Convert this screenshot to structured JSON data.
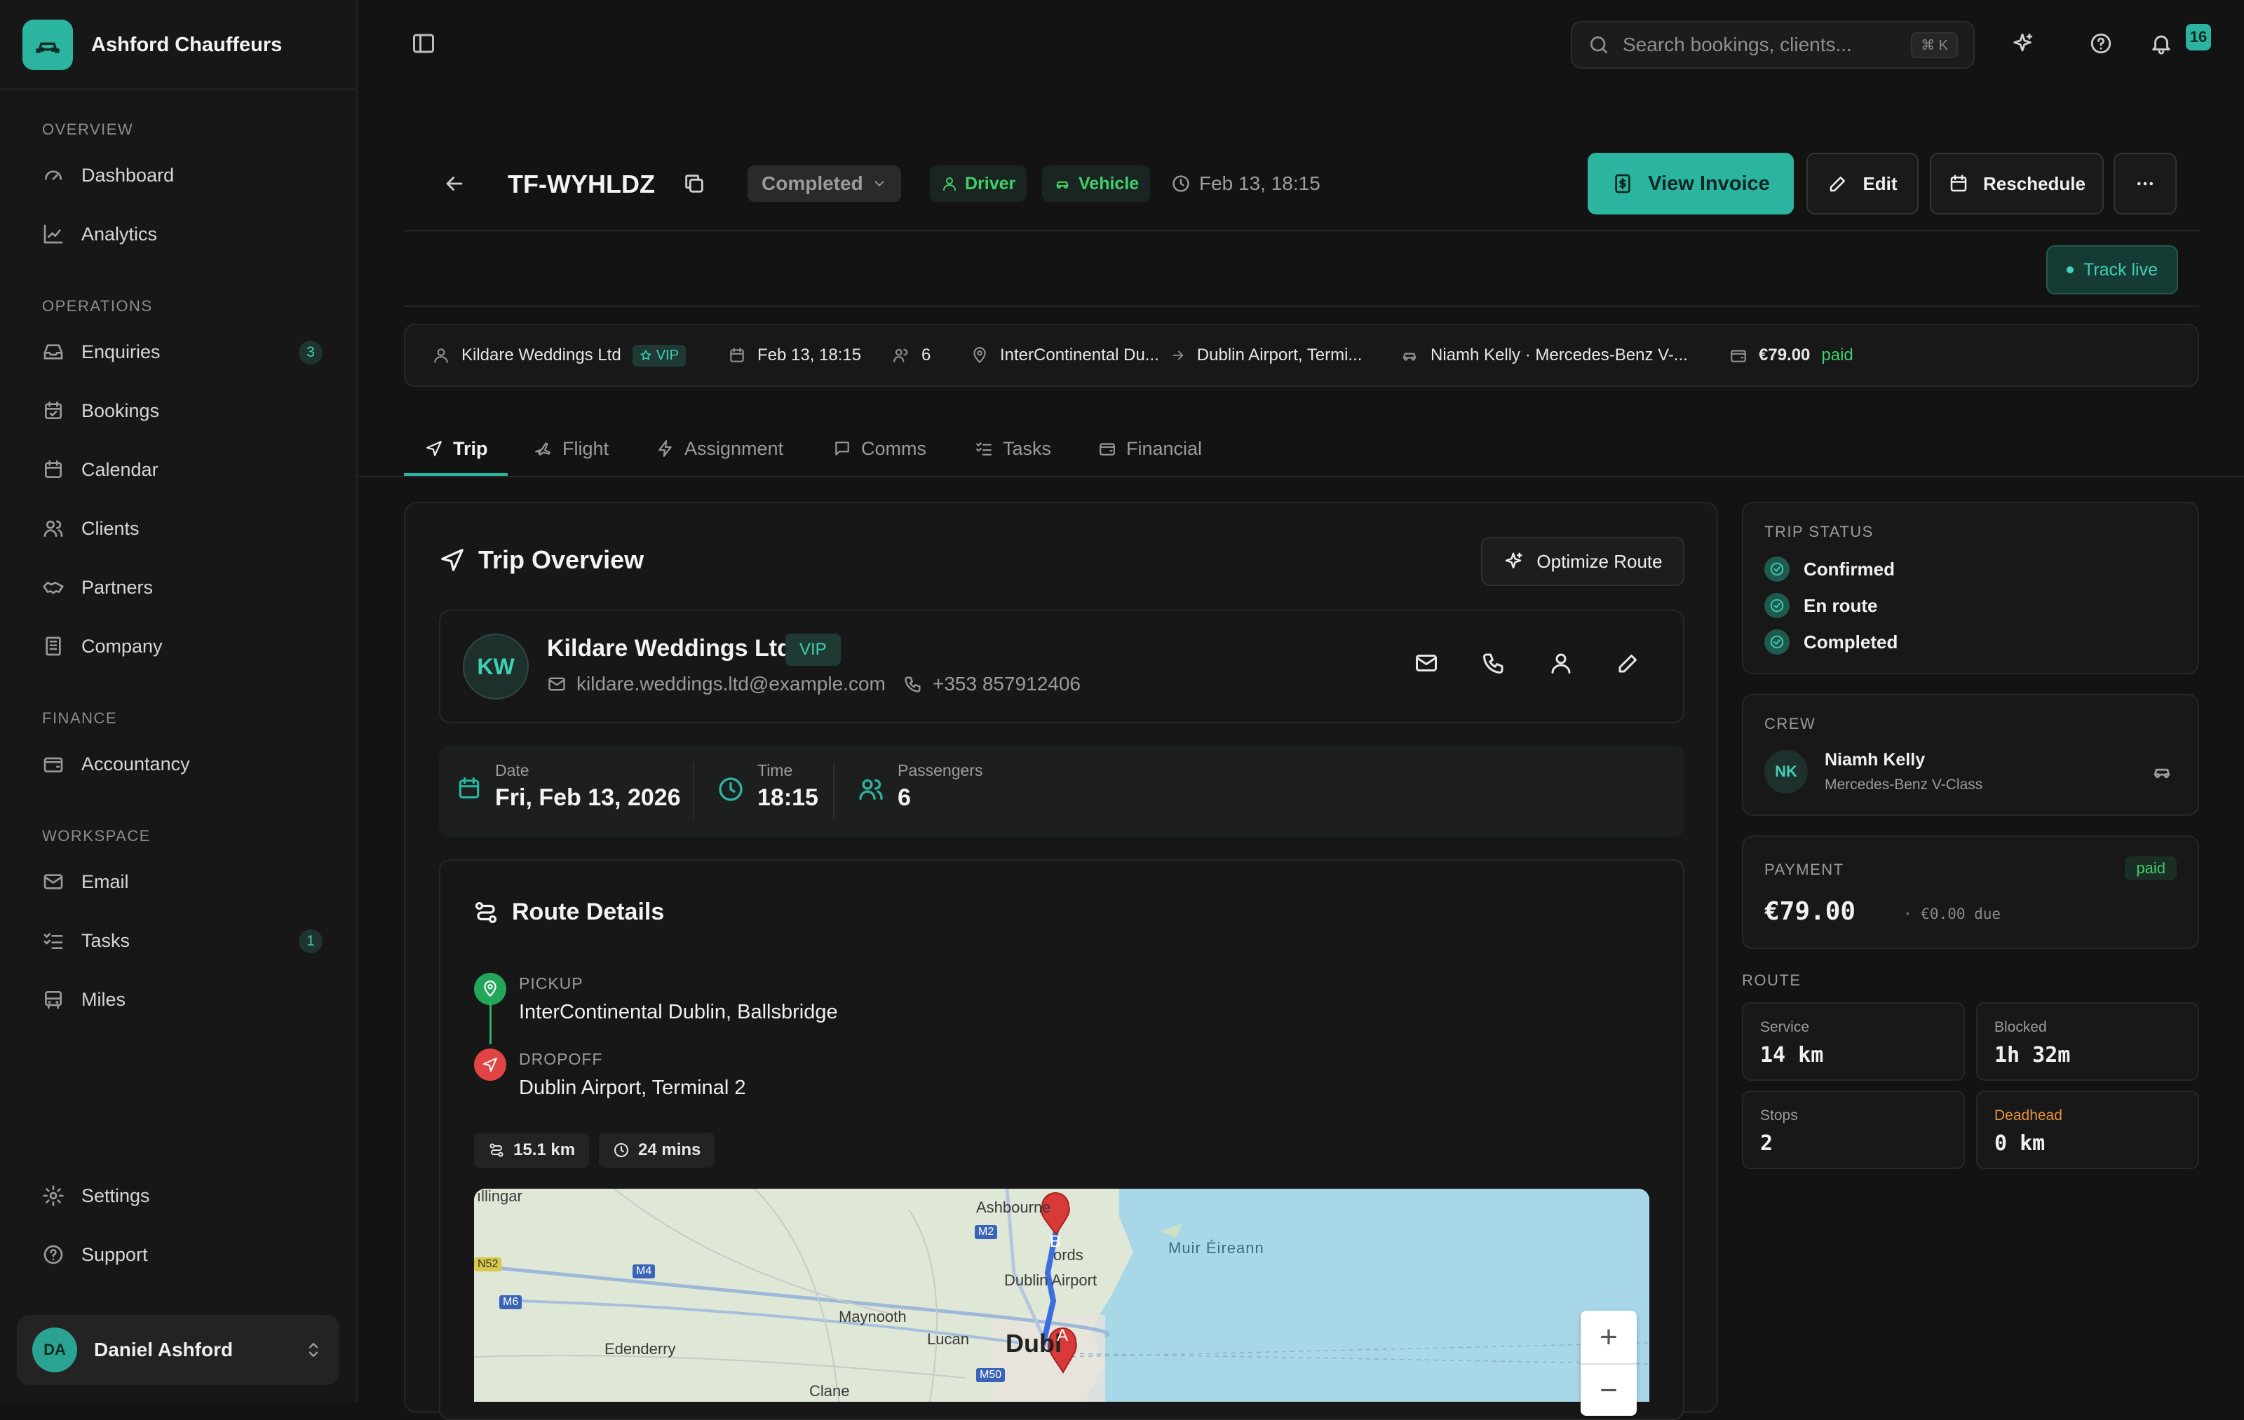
{
  "brand": {
    "name": "Ashford Chauffeurs"
  },
  "sidebar": {
    "sections": [
      {
        "label": "OVERVIEW"
      },
      {
        "label": "OPERATIONS"
      },
      {
        "label": "FINANCE"
      },
      {
        "label": "WORKSPACE"
      }
    ],
    "items": [
      {
        "label": "Dashboard",
        "icon": "dashboard-icon"
      },
      {
        "label": "Analytics",
        "icon": "analytics-icon"
      },
      {
        "label": "Enquiries",
        "icon": "inbox-icon",
        "badge": "3"
      },
      {
        "label": "Bookings",
        "icon": "calendar-check-icon"
      },
      {
        "label": "Calendar",
        "icon": "calendar-icon"
      },
      {
        "label": "Clients",
        "icon": "users-icon"
      },
      {
        "label": "Partners",
        "icon": "handshake-icon"
      },
      {
        "label": "Company",
        "icon": "building-icon"
      },
      {
        "label": "Accountancy",
        "icon": "wallet-icon"
      },
      {
        "label": "Email",
        "icon": "mail-icon"
      },
      {
        "label": "Tasks",
        "icon": "list-check-icon",
        "badge": "1"
      },
      {
        "label": "Miles",
        "icon": "bus-icon"
      },
      {
        "label": "Settings",
        "icon": "gear-icon"
      },
      {
        "label": "Support",
        "icon": "help-icon"
      }
    ],
    "user": {
      "initials": "DA",
      "name": "Daniel Ashford"
    }
  },
  "topbar": {
    "search_placeholder": "Search bookings, clients...",
    "shortcut": "⌘ K",
    "notification_count": "16"
  },
  "booking": {
    "id": "TF-WYHLDZ",
    "status": "Completed",
    "tags": [
      "Driver",
      "Vehicle"
    ],
    "datetime": "Feb 13, 18:15",
    "actions": {
      "invoice": "View Invoice",
      "edit": "Edit",
      "reschedule": "Reschedule"
    },
    "track_live": "Track live"
  },
  "summary": {
    "client": "Kildare Weddings Ltd",
    "vip": "VIP",
    "datetime": "Feb 13, 18:15",
    "passengers": "6",
    "pickup": "InterContinental Du...",
    "dropoff": "Dublin Airport, Termi...",
    "driver": "Niamh Kelly · Mercedes-Benz V-...",
    "amount": "€79.00",
    "amount_status": "paid"
  },
  "tabs": [
    "Trip",
    "Flight",
    "Assignment",
    "Comms",
    "Tasks",
    "Financial"
  ],
  "trip": {
    "title": "Trip Overview",
    "optimize_label": "Optimize Route",
    "client": {
      "initials": "KW",
      "name": "Kildare Weddings Ltd",
      "badge": "VIP",
      "email": "kildare.weddings.ltd@example.com",
      "phone": "+353 857912406"
    },
    "date": {
      "label": "Date",
      "value": "Fri, Feb 13, 2026"
    },
    "time": {
      "label": "Time",
      "value": "18:15"
    },
    "passengers": {
      "label": "Passengers",
      "value": "6"
    }
  },
  "route": {
    "title": "Route Details",
    "pickup": {
      "label": "PICKUP",
      "value": "InterContinental Dublin, Ballsbridge"
    },
    "dropoff": {
      "label": "DROPOFF",
      "value": "Dublin Airport, Terminal 2"
    },
    "distance": "15.1 km",
    "duration": "24 mins",
    "map_labels": {
      "mullingar": "ıllingar",
      "ashbourne": "Ashbourne",
      "swords": "ords",
      "airport": "Dublin Airport",
      "sea": "Muir Éireann",
      "maynooth": "Maynooth",
      "edenderry": "Edenderry",
      "lucan": "Lucan",
      "dublin": "Dubl",
      "clane": "Clane",
      "road_m2": "M2",
      "road_m4": "M4",
      "road_m6": "M6",
      "road_n52": "N52",
      "road_m50": "M50",
      "marker_a": "A",
      "marker_b": "B"
    }
  },
  "trip_status": {
    "label": "TRIP STATUS",
    "steps": [
      "Confirmed",
      "En route",
      "Completed"
    ]
  },
  "crew": {
    "label": "CREW",
    "initials": "NK",
    "name": "Niamh Kelly",
    "vehicle": "Mercedes-Benz V-Class"
  },
  "payment": {
    "label": "PAYMENT",
    "status": "paid",
    "amount": "€79.00",
    "due": "· €0.00 due"
  },
  "route_stats": {
    "label": "ROUTE",
    "service": {
      "label": "Service",
      "value": "14 km"
    },
    "blocked": {
      "label": "Blocked",
      "value": "1h 32m"
    },
    "stops": {
      "label": "Stops",
      "value": "2"
    },
    "deadhead": {
      "label": "Deadhead",
      "value": "0 km"
    }
  },
  "colors": {
    "accent": "#2bb5a0",
    "success": "#3fd06a",
    "warning": "#e8923a",
    "danger": "#e04444"
  }
}
